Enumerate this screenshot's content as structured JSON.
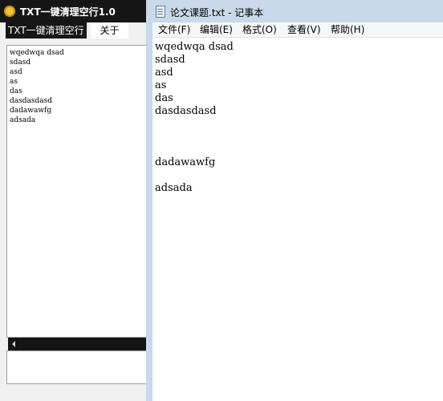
{
  "tool_window": {
    "title": "TXT一键清理空行1.0",
    "menu": {
      "clean_label": "TXT一键清理空行",
      "about_label": "关于"
    },
    "list_lines": [
      "wqedwqa dsad",
      "sdasd",
      "asd",
      "as",
      "das",
      "dasdasdasd",
      "dadawawfg",
      "adsada"
    ]
  },
  "notepad": {
    "title": "论文课题.txt - 记事本",
    "menu": {
      "file": "文件(F)",
      "edit": "编辑(E)",
      "format": "格式(O)",
      "view": "查看(V)",
      "help": "帮助(H)"
    },
    "content_lines": [
      "wqedwqa dsad",
      "sdasd",
      "asd",
      "as",
      "das",
      "dasdasdasd",
      "",
      "",
      "",
      "dadawawfg",
      "",
      "adsada"
    ]
  },
  "colors": {
    "tool_titlebar": "#161616",
    "notepad_frame": "#c9d8ea",
    "app_icon": "#f2c23a"
  },
  "icons": {
    "tool_app": "app-logo-icon",
    "notepad_app": "notepad-document-icon",
    "scroll_left": "arrow-left-icon"
  }
}
